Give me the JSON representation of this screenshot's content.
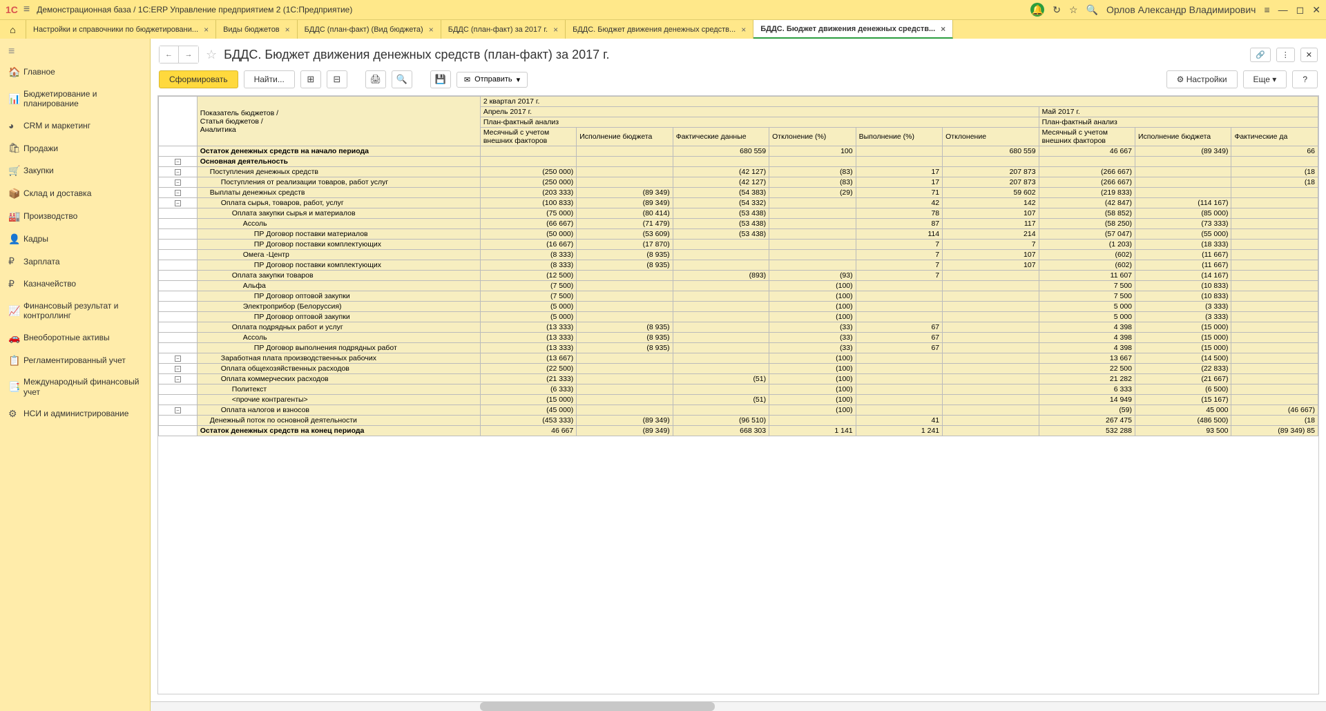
{
  "app": {
    "title": "Демонстрационная база / 1C:ERP Управление предприятием 2  (1С:Предприятие)",
    "user": "Орлов Александр Владимирович"
  },
  "tabs": [
    {
      "label": "Настройки и справочники по бюджетировани...",
      "close": "×"
    },
    {
      "label": "Виды  бюджетов",
      "close": "×"
    },
    {
      "label": "БДДС (план-факт) (Вид бюджета)",
      "close": "×"
    },
    {
      "label": "БДДС (план-факт)  за 2017 г.",
      "close": "×"
    },
    {
      "label": "БДДС. Бюджет движения денежных средств...",
      "close": "×"
    },
    {
      "label": "БДДС. Бюджет движения денежных средств...",
      "close": "×",
      "active": true
    }
  ],
  "sidebar": {
    "items": [
      {
        "icon": "🏠",
        "label": "Главное"
      },
      {
        "icon": "📊",
        "label": "Бюджетирование и планирование"
      },
      {
        "icon": "◕",
        "label": "CRM и маркетинг"
      },
      {
        "icon": "🛍",
        "label": "Продажи"
      },
      {
        "icon": "🛒",
        "label": "Закупки"
      },
      {
        "icon": "📦",
        "label": "Склад и доставка"
      },
      {
        "icon": "🏭",
        "label": "Производство"
      },
      {
        "icon": "👤",
        "label": "Кадры"
      },
      {
        "icon": "₽",
        "label": "Зарплата"
      },
      {
        "icon": "₽",
        "label": "Казначейство"
      },
      {
        "icon": "📈",
        "label": "Финансовый результат и контроллинг"
      },
      {
        "icon": "🚗",
        "label": "Внеоборотные активы"
      },
      {
        "icon": "📋",
        "label": "Регламентированный учет"
      },
      {
        "icon": "📑",
        "label": "Международный финансовый учет"
      },
      {
        "icon": "⚙",
        "label": "НСИ и администрирование"
      }
    ]
  },
  "page": {
    "title": "БДДС. Бюджет движения денежных средств (план-факт)  за 2017 г."
  },
  "toolbar": {
    "form_label": "Сформировать",
    "find_label": "Найти...",
    "send_label": "Отправить",
    "settings_label": "Настройки",
    "more_label": "Еще",
    "help_label": "?"
  },
  "columns": {
    "indicator": "Показатель бюджетов /\nСтатья бюджетов /\nАналитика",
    "quarter": "2 квартал 2017 г.",
    "month1": "Апрель 2017 г.",
    "month2": "Май 2017 г.",
    "pfa": "План-фактный анализ",
    "col1": "Месячный с учетом внешних факторов",
    "col2": "Исполнение бюджета",
    "col3": "Фактические данные",
    "col4": "Отклонение (%)",
    "col5": "Выполнение (%)",
    "col6": "Отклонение",
    "col_fd": "Фактические да"
  },
  "rows": [
    {
      "d": 0,
      "name": "Остаток денежных средств на начало периода",
      "v": [
        "",
        "",
        "680 559",
        "100",
        "",
        "680 559",
        "46 667",
        "(89 349)",
        "66"
      ]
    },
    {
      "d": 0,
      "name": "Основная деятельность",
      "v": [
        "",
        "",
        "",
        "",
        "",
        "",
        "",
        "",
        ""
      ]
    },
    {
      "d": 1,
      "name": "Поступления денежных средств",
      "v": [
        "(250 000)",
        "",
        "(42 127)",
        "(83)",
        "17",
        "207 873",
        "(266 667)",
        "",
        "(18"
      ]
    },
    {
      "d": 2,
      "name": "Поступления от реализации товаров, работ услуг",
      "v": [
        "(250 000)",
        "",
        "(42 127)",
        "(83)",
        "17",
        "207 873",
        "(266 667)",
        "",
        "(18"
      ]
    },
    {
      "d": 1,
      "name": "Выплаты денежных средств",
      "v": [
        "(203 333)",
        "(89 349)",
        "(54 383)",
        "(29)",
        "71",
        "59 602",
        "(219 833)",
        "",
        ""
      ]
    },
    {
      "d": 2,
      "name": "Оплата сырья, товаров, работ, услуг",
      "v": [
        "(100 833)",
        "(89 349)",
        "(54 332)",
        "",
        "42",
        "142",
        "(42 847)",
        "(114 167)",
        ""
      ]
    },
    {
      "d": 3,
      "name": "Оплата закупки сырья и материалов",
      "v": [
        "(75 000)",
        "(80 414)",
        "(53 438)",
        "",
        "78",
        "107",
        "(58 852)",
        "(85 000)",
        ""
      ]
    },
    {
      "d": 4,
      "name": "Ассоль",
      "v": [
        "(66 667)",
        "(71 479)",
        "(53 438)",
        "",
        "87",
        "117",
        "(58 250)",
        "(73 333)",
        ""
      ]
    },
    {
      "d": 5,
      "name": "ПР Договор поставки материалов",
      "v": [
        "(50 000)",
        "(53 609)",
        "(53 438)",
        "",
        "114",
        "214",
        "(57 047)",
        "(55 000)",
        ""
      ]
    },
    {
      "d": 5,
      "name": "ПР Договор поставки комплектующих",
      "v": [
        "(16 667)",
        "(17 870)",
        "",
        "",
        "7",
        "7",
        "(1 203)",
        "(18 333)",
        ""
      ]
    },
    {
      "d": 4,
      "name": "Омега -Центр",
      "v": [
        "(8 333)",
        "(8 935)",
        "",
        "",
        "7",
        "107",
        "(602)",
        "(11 667)",
        ""
      ]
    },
    {
      "d": 5,
      "name": "ПР Договор поставки комплектующих",
      "v": [
        "(8 333)",
        "(8 935)",
        "",
        "",
        "7",
        "107",
        "(602)",
        "(11 667)",
        ""
      ]
    },
    {
      "d": 3,
      "name": "Оплата закупки товаров",
      "v": [
        "(12 500)",
        "",
        "(893)",
        "(93)",
        "7",
        "",
        "11 607",
        "(14 167)",
        ""
      ]
    },
    {
      "d": 4,
      "name": "Альфа",
      "v": [
        "(7 500)",
        "",
        "",
        "(100)",
        "",
        "",
        "7 500",
        "(10 833)",
        ""
      ]
    },
    {
      "d": 5,
      "name": "ПР Договор оптовой закупки",
      "v": [
        "(7 500)",
        "",
        "",
        "(100)",
        "",
        "",
        "7 500",
        "(10 833)",
        ""
      ]
    },
    {
      "d": 4,
      "name": "Электроприбор (Белоруссия)",
      "v": [
        "(5 000)",
        "",
        "",
        "(100)",
        "",
        "",
        "5 000",
        "(3 333)",
        ""
      ]
    },
    {
      "d": 5,
      "name": "ПР Договор оптовой закупки",
      "v": [
        "(5 000)",
        "",
        "",
        "(100)",
        "",
        "",
        "5 000",
        "(3 333)",
        ""
      ]
    },
    {
      "d": 3,
      "name": "Оплата подрядных работ и услуг",
      "v": [
        "(13 333)",
        "(8 935)",
        "",
        "(33)",
        "67",
        "",
        "4 398",
        "(15 000)",
        ""
      ]
    },
    {
      "d": 4,
      "name": "Ассоль",
      "v": [
        "(13 333)",
        "(8 935)",
        "",
        "(33)",
        "67",
        "",
        "4 398",
        "(15 000)",
        ""
      ]
    },
    {
      "d": 5,
      "name": "ПР Договор выполнения подрядных работ",
      "v": [
        "(13 333)",
        "(8 935)",
        "",
        "(33)",
        "67",
        "",
        "4 398",
        "(15 000)",
        ""
      ]
    },
    {
      "d": 2,
      "name": "Заработная плата производственных рабочих",
      "v": [
        "(13 667)",
        "",
        "",
        "(100)",
        "",
        "",
        "13 667",
        "(14 500)",
        ""
      ]
    },
    {
      "d": 2,
      "name": "Оплата общехозяйственных расходов",
      "v": [
        "(22 500)",
        "",
        "",
        "(100)",
        "",
        "",
        "22 500",
        "(22 833)",
        ""
      ]
    },
    {
      "d": 2,
      "name": "Оплата коммерческих расходов",
      "v": [
        "(21 333)",
        "",
        "(51)",
        "(100)",
        "",
        "",
        "21 282",
        "(21 667)",
        ""
      ]
    },
    {
      "d": 3,
      "name": "Политекст",
      "v": [
        "(6 333)",
        "",
        "",
        "(100)",
        "",
        "",
        "6 333",
        "(6 500)",
        ""
      ]
    },
    {
      "d": 3,
      "name": "<прочие контрагенты>",
      "v": [
        "(15 000)",
        "",
        "(51)",
        "(100)",
        "",
        "",
        "14 949",
        "(15 167)",
        ""
      ]
    },
    {
      "d": 2,
      "name": "Оплата налогов и взносов",
      "v": [
        "(45 000)",
        "",
        "",
        "(100)",
        "",
        "",
        "(59)",
        "45 000",
        "(46 667)"
      ]
    },
    {
      "d": 1,
      "name": "Денежный поток по основной деятельности",
      "v": [
        "(453 333)",
        "(89 349)",
        "(96 510)",
        "",
        "41",
        "",
        "267 475",
        "(486 500)",
        "(18"
      ]
    },
    {
      "d": 0,
      "name": "Остаток денежных средств на конец периода",
      "v": [
        "46 667",
        "(89 349)",
        "668 303",
        "1 141",
        "1 241",
        "",
        "532 288",
        "93 500",
        "(89 349)        85"
      ]
    }
  ]
}
